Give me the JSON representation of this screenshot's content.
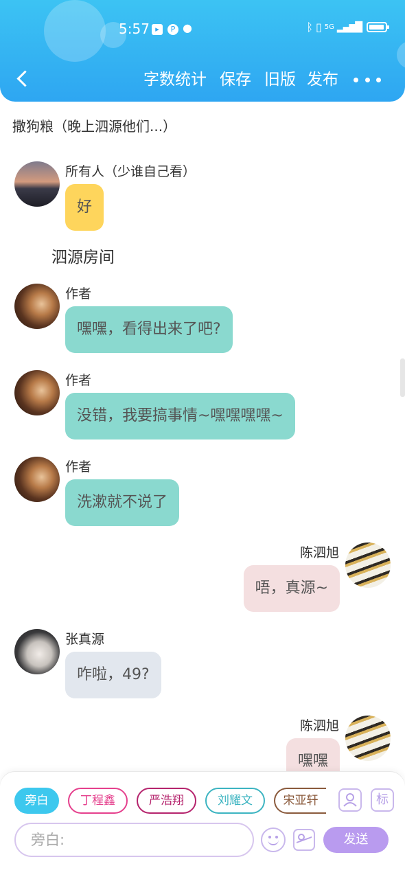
{
  "status_bar": {
    "time": "5:57",
    "network": "5G"
  },
  "nav": {
    "word_count": "字数统计",
    "save": "保存",
    "old_version": "旧版",
    "publish": "发布"
  },
  "story": {
    "title": "撒狗粮（晚上泗源他们...）"
  },
  "messages": [
    {
      "sender": "所有人（少谁自己看）",
      "text": "好",
      "side": "left",
      "bubble_color": "#fed55c"
    },
    {
      "sender": "作者",
      "text": "嘿嘿，看得出来了吧?",
      "side": "left",
      "bubble_color": "#8ad9cf"
    },
    {
      "sender": "作者",
      "text": "没错，我要搞事情~嘿嘿嘿嘿~",
      "side": "left",
      "bubble_color": "#8ad9cf"
    },
    {
      "sender": "作者",
      "text": "洗漱就不说了",
      "side": "left",
      "bubble_color": "#8ad9cf"
    },
    {
      "sender": "陈泗旭",
      "text": "唔，真源~",
      "side": "right",
      "bubble_color": "#f4dfe0"
    },
    {
      "sender": "张真源",
      "text": "咋啦，49?",
      "side": "left",
      "bubble_color": "#e2e7ee"
    },
    {
      "sender": "陈泗旭",
      "text": "嘿嘿",
      "side": "right",
      "bubble_color": "#f4dfe0"
    }
  ],
  "narration": "泗源房间",
  "characters": [
    {
      "label": "旁白",
      "color": "#3dc8ee",
      "active": true
    },
    {
      "label": "丁程鑫",
      "color": "#e5408d",
      "active": false
    },
    {
      "label": "严浩翔",
      "color": "#b5246d",
      "active": false
    },
    {
      "label": "刘耀文",
      "color": "#3cb4c1",
      "active": false
    },
    {
      "label": "宋亚轩",
      "color": "#8a5a3c",
      "active": false
    }
  ],
  "tag_button": "标",
  "input": {
    "placeholder": "旁白:"
  },
  "send_label": "发送",
  "colors": {
    "header": "#2ea6f2",
    "send": "#b99bef",
    "accent": "#c9b8ec"
  },
  "icons": [
    "back-arrow-icon",
    "more-icon",
    "character-card-icon",
    "emoji-icon",
    "image-icon"
  ]
}
